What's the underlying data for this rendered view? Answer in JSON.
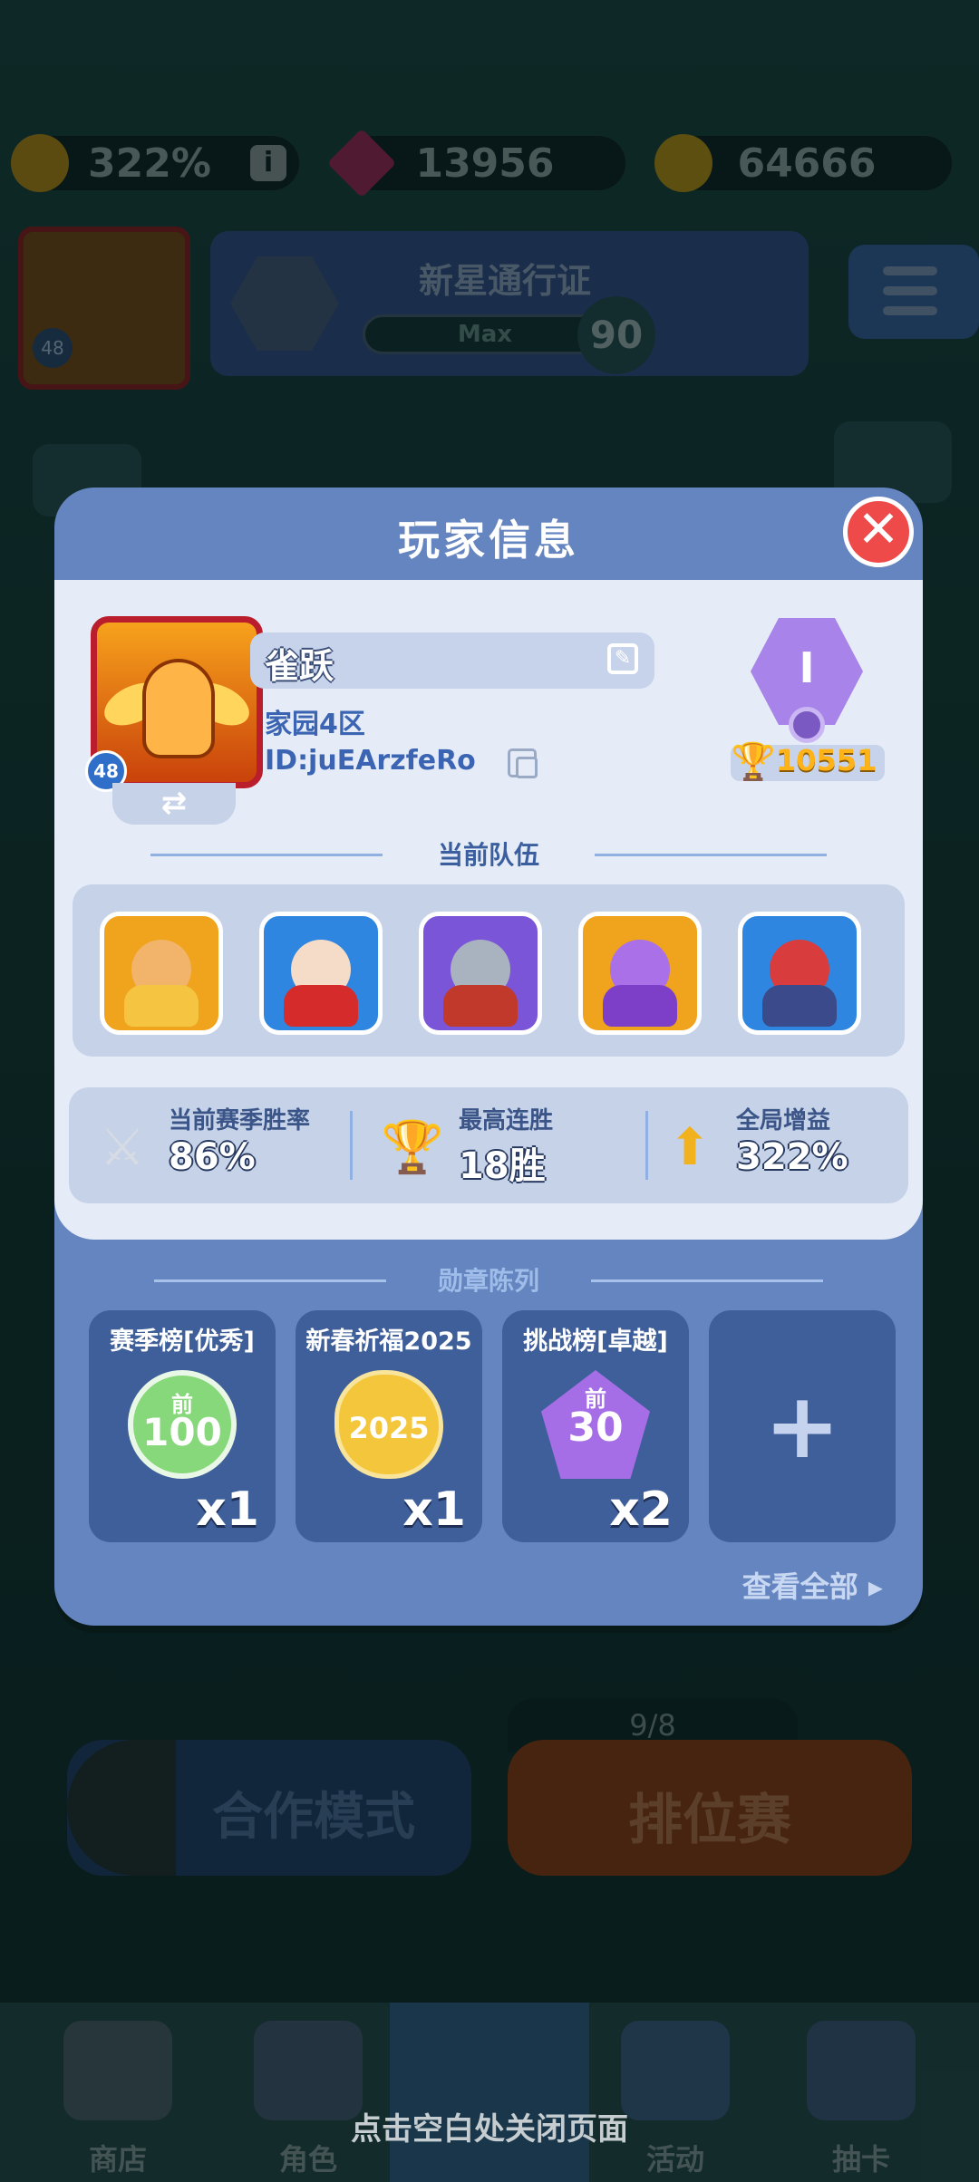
{
  "background": {
    "resources": {
      "boost": "322%",
      "gems": "13956",
      "coins": "64666",
      "info_icon": "i"
    },
    "avatar_level": "48",
    "pass": {
      "title": "新星通行证",
      "bar_label": "Max",
      "level": "90"
    },
    "coop_label": "合作模式",
    "ranked_label": "排位赛",
    "ranked_count": "9/8",
    "nav": [
      "商店",
      "角色",
      "",
      "活动",
      "抽卡"
    ]
  },
  "modal": {
    "title": "玩家信息",
    "close_icon": "✕",
    "profile": {
      "name": "雀跃",
      "server": "家园4区",
      "id": "ID:juEArzfeRo",
      "level": "48",
      "swap_icon": "⇄",
      "rank_numeral": "I",
      "trophies": "10551"
    },
    "team_header": "当前队伍",
    "team": [
      {
        "name": "gold-knight",
        "bg": "#f0a31c",
        "face": "#f2b36a",
        "body": "#f5c542"
      },
      {
        "name": "girl-fighter",
        "bg": "#2f86e0",
        "face": "#f4dcc8",
        "body": "#d52b2b"
      },
      {
        "name": "armor-knight",
        "bg": "#7a55d8",
        "face": "#a9b3c0",
        "body": "#c0392b"
      },
      {
        "name": "purple-demon",
        "bg": "#f0a31c",
        "face": "#a970e8",
        "body": "#7d3fc8"
      },
      {
        "name": "mask-warrior",
        "bg": "#2f86e0",
        "face": "#d93c3c",
        "body": "#3a4a8a"
      }
    ],
    "stats": [
      {
        "label": "当前赛季胜率",
        "value": "86%",
        "icon": "⚔"
      },
      {
        "label": "最高连胜",
        "value": "18胜",
        "icon": "🏆"
      },
      {
        "label": "全局增益",
        "value": "322%",
        "icon": "⬆"
      }
    ],
    "badge_header": "勋章陈列",
    "badges": [
      {
        "title": "赛季榜[优秀]",
        "top": "前",
        "rank": "100",
        "count": "x1",
        "color": "#86d87a"
      },
      {
        "title": "新春祈福2025",
        "top": "",
        "rank": "2025",
        "count": "x1",
        "color": "#f3c63b"
      },
      {
        "title": "挑战榜[卓越]",
        "top": "前",
        "rank": "30",
        "count": "x2",
        "color": "#a66ee6"
      }
    ],
    "add_icon": "+",
    "view_all": "查看全部 ▸"
  },
  "close_hint": "点击空白处关闭页面"
}
